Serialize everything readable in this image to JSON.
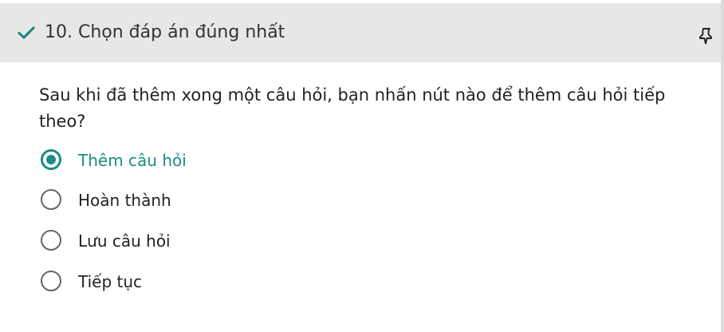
{
  "header": {
    "title": "10. Chọn đáp án đúng nhất",
    "status_icon": "check-icon",
    "pin_icon": "pin-icon"
  },
  "question": {
    "text": "Sau khi đã thêm xong một câu hỏi, bạn nhấn nút nào để thêm câu hỏi tiếp theo?"
  },
  "options": [
    {
      "label": "Thêm câu hỏi",
      "selected": true
    },
    {
      "label": "Hoàn thành",
      "selected": false
    },
    {
      "label": "Lưu câu hỏi",
      "selected": false
    },
    {
      "label": "Tiếp tục",
      "selected": false
    }
  ],
  "colors": {
    "accent": "#1a8c80",
    "header_bg": "#e7e7e7",
    "text": "#222222"
  }
}
